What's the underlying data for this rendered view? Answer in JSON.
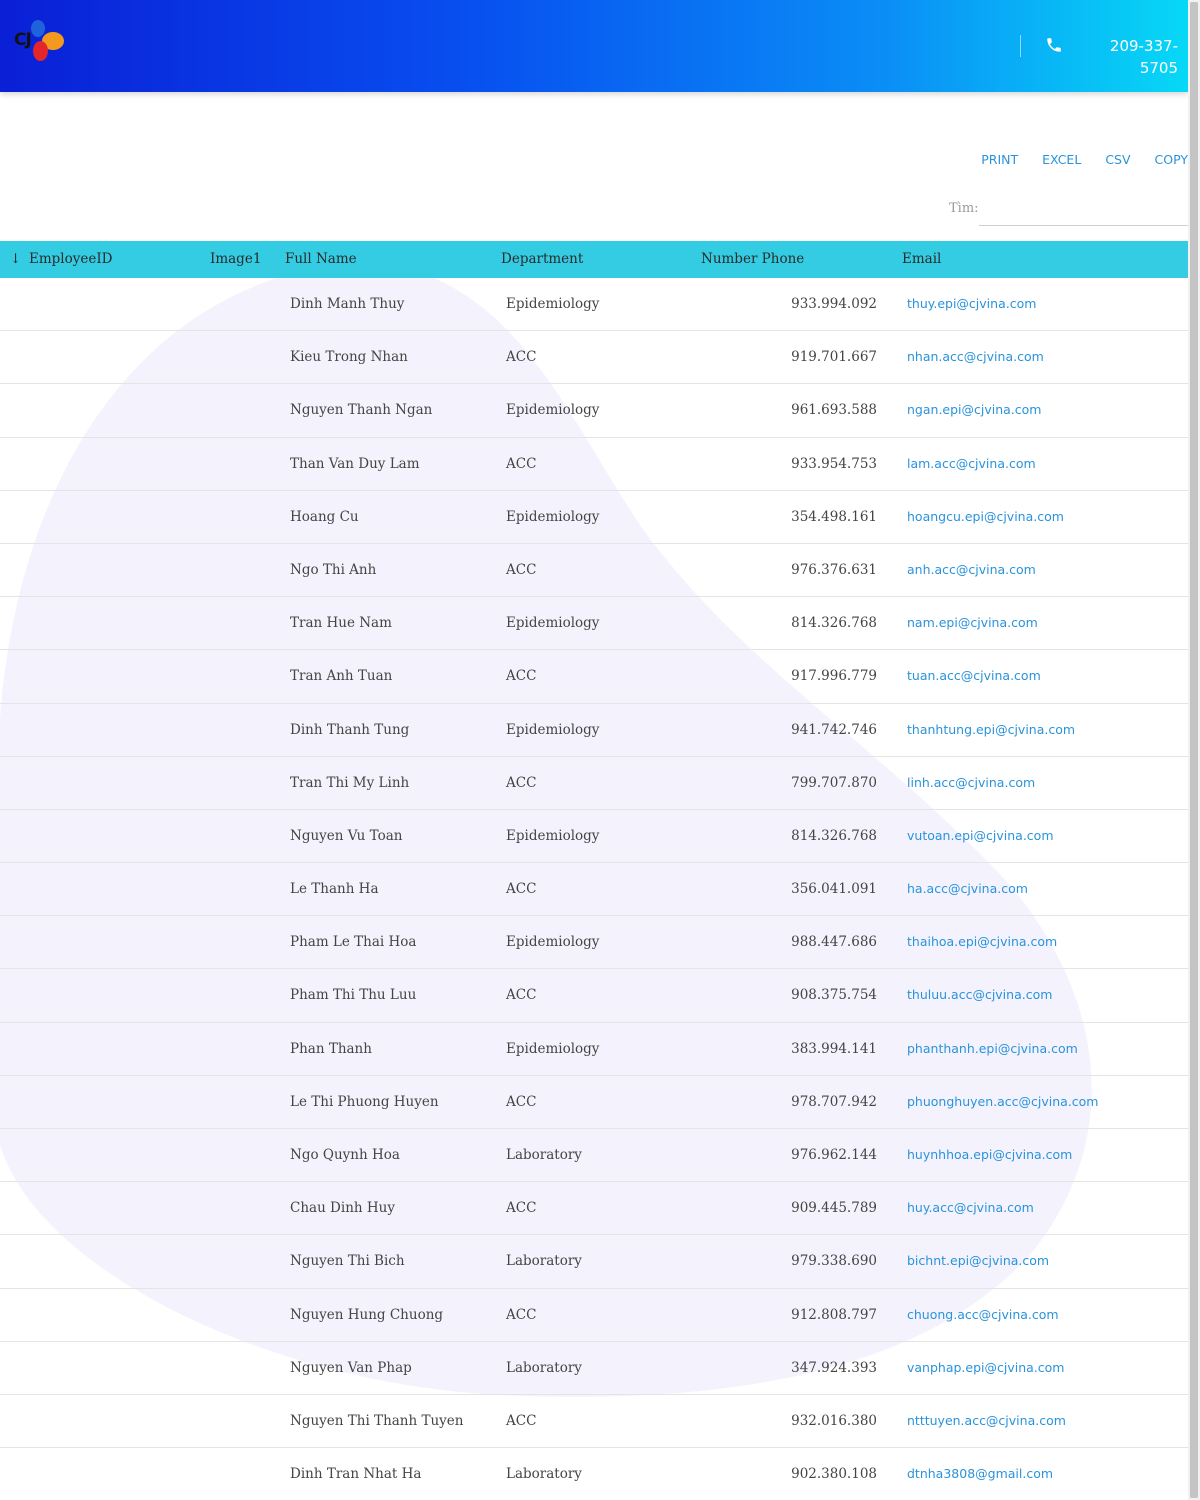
{
  "header": {
    "logo_text": "CJ",
    "phone_number": "209-337-5705",
    "gradient_colors": [
      "#0a1fd6",
      "#07d8f6"
    ]
  },
  "toolbar": {
    "print_label": "PRINT",
    "excel_label": "EXCEL",
    "csv_label": "CSV",
    "copy_label": "COPY"
  },
  "search": {
    "label": "Tìm:",
    "value": ""
  },
  "table": {
    "header_color": "#33cce3",
    "link_color": "#2a93db",
    "columns": {
      "sort_arrow": "↓",
      "employee_id": "EmployeeID",
      "image": "Image1",
      "full_name": "Full Name",
      "department": "Department",
      "phone": "Number Phone",
      "email": "Email"
    },
    "rows": [
      {
        "full_name": "Dinh Manh Thuy",
        "department": "Epidemiology",
        "phone": "933.994.092",
        "email": "thuy.epi@cjvina.com"
      },
      {
        "full_name": "Kieu Trong Nhan",
        "department": "ACC",
        "phone": "919.701.667",
        "email": "nhan.acc@cjvina.com"
      },
      {
        "full_name": "Nguyen Thanh Ngan",
        "department": "Epidemiology",
        "phone": "961.693.588",
        "email": "ngan.epi@cjvina.com"
      },
      {
        "full_name": "Than Van Duy Lam",
        "department": "ACC",
        "phone": "933.954.753",
        "email": "lam.acc@cjvina.com"
      },
      {
        "full_name": "Hoang Cu",
        "department": "Epidemiology",
        "phone": "354.498.161",
        "email": "hoangcu.epi@cjvina.com"
      },
      {
        "full_name": "Ngo Thi Anh",
        "department": "ACC",
        "phone": "976.376.631",
        "email": "anh.acc@cjvina.com"
      },
      {
        "full_name": "Tran Hue Nam",
        "department": "Epidemiology",
        "phone": "814.326.768",
        "email": "nam.epi@cjvina.com"
      },
      {
        "full_name": "Tran Anh Tuan",
        "department": "ACC",
        "phone": "917.996.779",
        "email": "tuan.acc@cjvina.com"
      },
      {
        "full_name": "Dinh Thanh Tung",
        "department": "Epidemiology",
        "phone": "941.742.746",
        "email": "thanhtung.epi@cjvina.com"
      },
      {
        "full_name": "Tran Thi My Linh",
        "department": "ACC",
        "phone": "799.707.870",
        "email": "linh.acc@cjvina.com"
      },
      {
        "full_name": "Nguyen Vu Toan",
        "department": "Epidemiology",
        "phone": "814.326.768",
        "email": "vutoan.epi@cjvina.com"
      },
      {
        "full_name": "Le Thanh Ha",
        "department": "ACC",
        "phone": "356.041.091",
        "email": "ha.acc@cjvina.com"
      },
      {
        "full_name": "Pham Le Thai Hoa",
        "department": "Epidemiology",
        "phone": "988.447.686",
        "email": "thaihoa.epi@cjvina.com"
      },
      {
        "full_name": "Pham Thi Thu Luu",
        "department": "ACC",
        "phone": "908.375.754",
        "email": "thuluu.acc@cjvina.com"
      },
      {
        "full_name": "Phan Thanh",
        "department": "Epidemiology",
        "phone": "383.994.141",
        "email": "phanthanh.epi@cjvina.com"
      },
      {
        "full_name": "Le Thi Phuong Huyen",
        "department": "ACC",
        "phone": "978.707.942",
        "email": "phuonghuyen.acc@cjvina.com"
      },
      {
        "full_name": "Ngo Quynh Hoa",
        "department": "Laboratory",
        "phone": "976.962.144",
        "email": "huynhhoa.epi@cjvina.com"
      },
      {
        "full_name": "Chau Dinh Huy",
        "department": "ACC",
        "phone": "909.445.789",
        "email": "huy.acc@cjvina.com"
      },
      {
        "full_name": "Nguyen Thi Bich",
        "department": "Laboratory",
        "phone": "979.338.690",
        "email": "bichnt.epi@cjvina.com"
      },
      {
        "full_name": "Nguyen Hung Chuong",
        "department": "ACC",
        "phone": "912.808.797",
        "email": "chuong.acc@cjvina.com"
      },
      {
        "full_name": "Nguyen Van Phap",
        "department": "Laboratory",
        "phone": "347.924.393",
        "email": "vanphap.epi@cjvina.com"
      },
      {
        "full_name": "Nguyen Thi Thanh Tuyen",
        "department": "ACC",
        "phone": "932.016.380",
        "email": "ntttuyen.acc@cjvina.com"
      },
      {
        "full_name": "Dinh Tran Nhat Ha",
        "department": "Laboratory",
        "phone": "902.380.108",
        "email": "dtnha3808@gmail.com"
      }
    ]
  }
}
